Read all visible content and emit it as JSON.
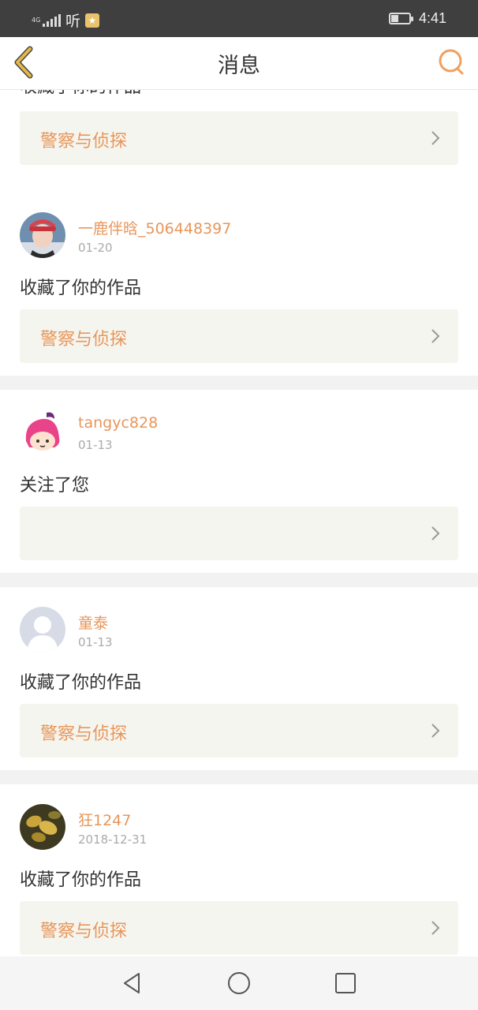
{
  "status_bar": {
    "network": "4G",
    "app_glyph": "听",
    "time": "4:41",
    "battery_level": 0.3
  },
  "header": {
    "title": "消息",
    "back_icon": "chevron-left-icon",
    "search_icon": "search-icon"
  },
  "partial_item": {
    "action": "收藏了你的作品",
    "work_title": "警察与侦探"
  },
  "notifications": [
    {
      "username": "一鹿伴晗_506448397",
      "date": "01-20",
      "action": "收藏了你的作品",
      "work_title": "警察与侦探",
      "avatar": "photo"
    },
    {
      "username": "tangyc828",
      "date": "01-13",
      "action": "关注了您",
      "work_title": "",
      "avatar": "cartoon"
    },
    {
      "username": "童泰",
      "date": "01-13",
      "action": "收藏了你的作品",
      "work_title": "警察与侦探",
      "avatar": "default"
    },
    {
      "username": "狂1247",
      "date": "2018-12-31",
      "action": "收藏了你的作品",
      "work_title": "警察与侦探",
      "avatar": "leaves"
    }
  ],
  "colors": {
    "accent": "#e8965a",
    "back_arrow": "#e3b948",
    "card_bg": "#f5f5ef"
  },
  "nav": [
    "back-triangle-icon",
    "home-circle-icon",
    "recents-square-icon"
  ]
}
